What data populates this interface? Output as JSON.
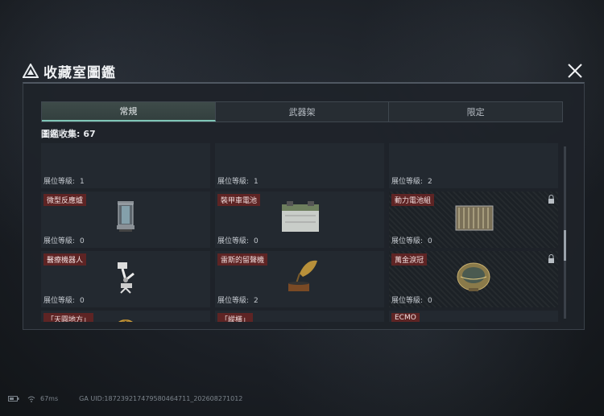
{
  "title": "收藏室圖鑑",
  "tabs": [
    "常規",
    "武器架",
    "限定"
  ],
  "active_tab": 0,
  "collection_label": "圖鑑收集:",
  "collection_count": "67",
  "level_label": "展位等級:",
  "cards": [
    {
      "name": "",
      "level": "1",
      "icon": "top-clipped-row",
      "locked": false
    },
    {
      "name": "",
      "level": "1",
      "icon": "top-clipped-row",
      "locked": false
    },
    {
      "name": "",
      "level": "2",
      "icon": "top-clipped-row",
      "locked": false
    },
    {
      "name": "微型反應爐",
      "level": "0",
      "icon": "reactor-icon",
      "locked": false
    },
    {
      "name": "裝甲車電池",
      "level": "0",
      "icon": "battery-icon",
      "locked": false
    },
    {
      "name": "動力電池組",
      "level": "0",
      "icon": "battery-pack-icon",
      "locked": true
    },
    {
      "name": "醫療機器人",
      "level": "0",
      "icon": "robot-arm-icon",
      "locked": false
    },
    {
      "name": "雷斯的留聲機",
      "level": "2",
      "icon": "gramophone-icon",
      "locked": false
    },
    {
      "name": "萬金淚冠",
      "level": "0",
      "icon": "crown-egg-icon",
      "locked": true
    },
    {
      "name": "「天圓地方」",
      "level": "",
      "icon": "armillary-icon",
      "locked": false
    },
    {
      "name": "「縱橫」",
      "level": "",
      "icon": "chessboard-icon",
      "locked": false
    },
    {
      "name": "ECMO",
      "level": "",
      "icon": "ecmo-icon",
      "locked": false
    }
  ],
  "status": {
    "ping": "67ms",
    "uid": "GA UID:18723921747958046471​1_202608271012"
  }
}
